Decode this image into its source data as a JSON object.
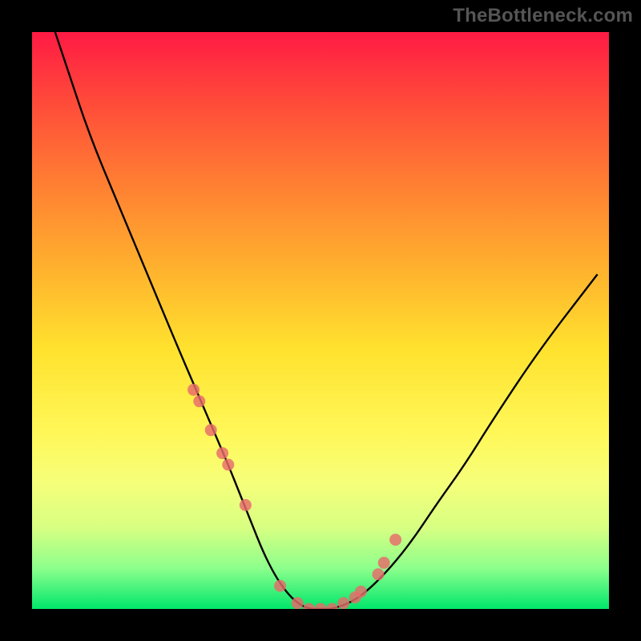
{
  "watermark": "TheBottleneck.com",
  "chart_data": {
    "type": "line",
    "title": "",
    "xlabel": "",
    "ylabel": "",
    "xlim": [
      0,
      100
    ],
    "ylim": [
      0,
      100
    ],
    "grid": false,
    "legend": null,
    "series": [
      {
        "name": "bottleneck-curve",
        "x": [
          4,
          6,
          10,
          15,
          20,
          25,
          28,
          31,
          34,
          36,
          38,
          40,
          42,
          44,
          46,
          48,
          50,
          52,
          55,
          58,
          62,
          66,
          70,
          75,
          80,
          88,
          98
        ],
        "values": [
          100,
          94,
          82,
          70,
          58,
          46,
          39,
          32,
          25,
          20,
          15,
          10,
          6,
          3,
          1,
          0,
          0,
          0,
          1,
          3,
          7,
          12,
          18,
          25,
          33,
          45,
          58
        ]
      }
    ],
    "markers": {
      "name": "highlight-points",
      "x": [
        28,
        29,
        31,
        33,
        34,
        37,
        43,
        46,
        48,
        50,
        52,
        54,
        56,
        57,
        60,
        61,
        63
      ],
      "values": [
        38,
        36,
        31,
        27,
        25,
        18,
        4,
        1,
        0,
        0,
        0,
        1,
        2,
        3,
        6,
        8,
        12
      ]
    },
    "gradient_stops": [
      {
        "pos": 0,
        "color": "#ff1a44"
      },
      {
        "pos": 25,
        "color": "#ff7a33"
      },
      {
        "pos": 55,
        "color": "#ffe22e"
      },
      {
        "pos": 78,
        "color": "#f6ff7a"
      },
      {
        "pos": 100,
        "color": "#00e66b"
      }
    ]
  }
}
